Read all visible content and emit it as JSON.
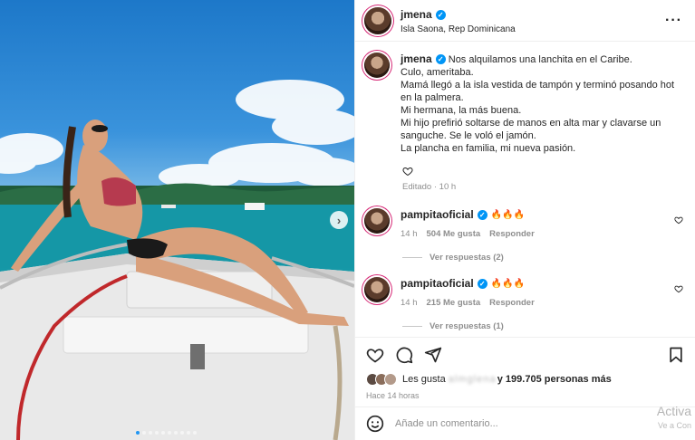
{
  "post": {
    "username": "jmena",
    "location": "Isla Saona, Rep Dominicana",
    "caption_lines": [
      "Nos alquilamos una lanchita en el Caribe.",
      "Culo, ameritaba.",
      "Mamá llegó a la isla vestida de tampón y terminó posando hot",
      "en la palmera.",
      "Mi hermana, la más buena.",
      "Mi hijo prefirió soltarse de manos en alta mar y clavarse un",
      "sanguche. Se le voló el jamón.",
      "La plancha en familia, mi nueva pasión."
    ],
    "edited_meta": "Editado · 10 h",
    "carousel_total": 10,
    "carousel_active": 0
  },
  "comments": [
    {
      "username": "pampitaoficial",
      "text": "🔥🔥🔥",
      "time": "14 h",
      "likes": "504 Me gusta",
      "reply_label": "Responder",
      "view_replies": "Ver respuestas (2)"
    },
    {
      "username": "pampitaoficial",
      "text": "🔥🔥🔥",
      "time": "14 h",
      "likes": "215 Me gusta",
      "reply_label": "Responder",
      "view_replies": "Ver respuestas (1)"
    }
  ],
  "likes": {
    "prefix": "Les gusta",
    "blurred": "a l m g l e n a",
    "count_text": "y 199.705 personas más"
  },
  "posted_ago": "Hace 14 horas",
  "add_comment": {
    "placeholder": "Añade un comentario..."
  },
  "watermark": {
    "line1": "Activa",
    "line2": "Ve a Con"
  },
  "icons": {
    "more": "more-horizontal-icon",
    "like": "heart-icon",
    "comment": "comment-icon",
    "share": "send-icon",
    "save": "bookmark-icon",
    "emoji": "emoji-icon",
    "next": "chevron-right-icon"
  },
  "colors": {
    "verified": "#0095f6",
    "link_meta": "#8e8e8e",
    "active_dot": "#2196f3"
  }
}
